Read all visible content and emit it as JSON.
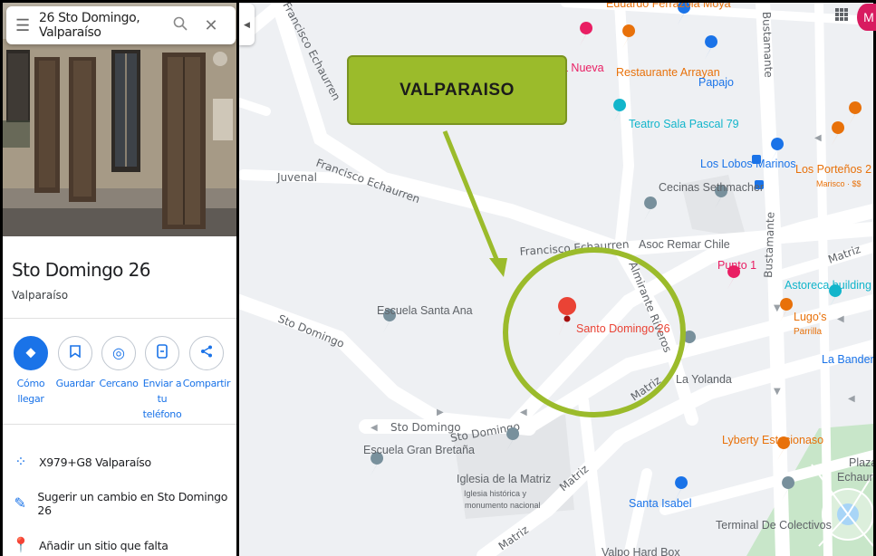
{
  "search": {
    "query": "26 Sto Domingo, Valparaíso"
  },
  "place": {
    "title": "Sto Domingo 26",
    "subtitle": "Valparaíso"
  },
  "actions": [
    {
      "label": "Cómo llegar",
      "icon": "directions-icon"
    },
    {
      "label": "Guardar",
      "icon": "bookmark-icon"
    },
    {
      "label": "Cercano",
      "icon": "nearby-icon"
    },
    {
      "label": "Enviar a tu teléfono",
      "line1": "Enviar a tu",
      "line2": "teléfono",
      "icon": "send-to-phone-icon"
    },
    {
      "label": "Compartir",
      "icon": "share-icon"
    }
  ],
  "info": {
    "plus_code": "X979+G8 Valparaíso",
    "suggest_edit": "Sugerir un cambio en Sto Domingo 26",
    "add_place": "Añadir un sitio que falta"
  },
  "avatar_initial": "M",
  "callout": {
    "text": "VALPARAISO"
  },
  "map": {
    "streets": {
      "francisco_echaurren_top": "Francisco Echaurren",
      "francisco_echaurren_mid": "Francisco Echaurren",
      "francisco_echaurren_right": "Francisco Echaurren",
      "juvenal": "Juvenal",
      "sto_domingo_left": "Sto Domingo",
      "sto_domingo_bottom": "Sto Domingo",
      "sto_domingo_bottom2": "Sto Domingo",
      "almirante_riveros": "Almirante Riveros",
      "bustamante_top": "Bustamante",
      "bustamante_mid": "Bustamante",
      "matriz_1": "Matriz",
      "matriz_2": "Matriz",
      "matriz_3": "Matriz",
      "matriz_right": "Matriz"
    },
    "pois": {
      "eduardo": "Eduardo Ferrazola Moya",
      "nueva": "a Nueva",
      "arrayan": "Restaurante Arrayan",
      "papajo": "Papajo",
      "teatro": "Teatro Sala Pascal 79",
      "lobos": "Los Lobos Marinos",
      "portenos": "Los Porteños 2",
      "portenos_sub": "Marisco · $$",
      "cecinas": "Cecinas Sethmacher",
      "asoc": "Asoc Remar Chile",
      "punto1": "Punto 1",
      "astoreca": "Astoreca building",
      "lugos": "Lugo's",
      "lugos_sub": "Parrilla",
      "bandera": "La Bandera A",
      "escuela_santa_ana": "Escuela Santa Ana",
      "santo_domingo_26": "Santo Domingo 26",
      "la_yolanda": "La Yolanda",
      "escuela_gran_bretana": "Escuela Gran Bretaña",
      "iglesia": "Iglesia de la Matriz",
      "iglesia_sub1": "Iglesia histórica y",
      "iglesia_sub2": "monumento nacional",
      "liberty": "Lyberty Estacionaso",
      "santa_isabel": "Santa Isabel",
      "terminal": "Terminal De Colectivos",
      "plaza1": "Plaza",
      "plaza2": "Echaurre",
      "valpo_hard_box": "Valpo Hard Box"
    }
  },
  "colors": {
    "primary_blue": "#1a73e8",
    "pin_red": "#ea4335",
    "food_orange": "#e8710a",
    "callout_green": "#9bbb2b",
    "ring_green": "#9bbb2b",
    "poi_teal": "#12b5cb",
    "poi_pink": "#e91e63",
    "park_green": "#c8e6c9"
  }
}
